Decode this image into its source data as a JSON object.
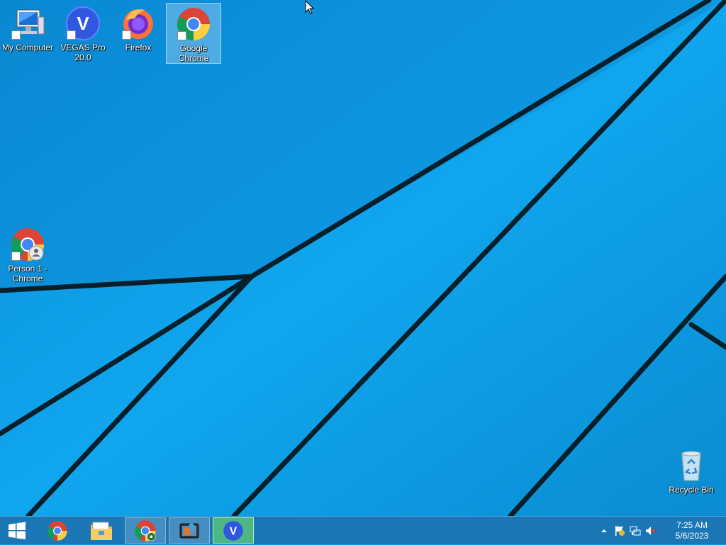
{
  "desktop": {
    "icons": [
      {
        "label": "My Computer",
        "icon": "computer-icon"
      },
      {
        "label": "VEGAS Pro 20.0",
        "icon": "vegas-pro-icon"
      },
      {
        "label": "Firefox",
        "icon": "firefox-icon"
      },
      {
        "label": "Google Chrome",
        "icon": "chrome-icon",
        "selected": true
      },
      {
        "label": "Person 1 - Chrome",
        "icon": "chrome-profile-icon"
      },
      {
        "label": "Recycle Bin",
        "icon": "recycle-bin-icon"
      }
    ]
  },
  "taskbar": {
    "start_icon": "windows-start-icon",
    "buttons": [
      {
        "icon": "chrome-icon",
        "state": "pinned"
      },
      {
        "icon": "file-explorer-icon",
        "state": "pinned"
      },
      {
        "icon": "chrome-profile-icon",
        "state": "running"
      },
      {
        "icon": "tablet-app-icon",
        "state": "running"
      },
      {
        "icon": "vegas-pro-icon",
        "state": "active"
      }
    ],
    "tray": {
      "icons": [
        "show-hidden-icons-chevron",
        "action-center-flag-icon",
        "network-icon",
        "volume-muted-icon"
      ],
      "clock": {
        "time": "7:25 AM",
        "date": "5/6/2023"
      }
    }
  },
  "colors": {
    "wallpaper": "#0e9ce6",
    "taskbar": "#1e6eaa",
    "active_button": "#5ac878"
  }
}
